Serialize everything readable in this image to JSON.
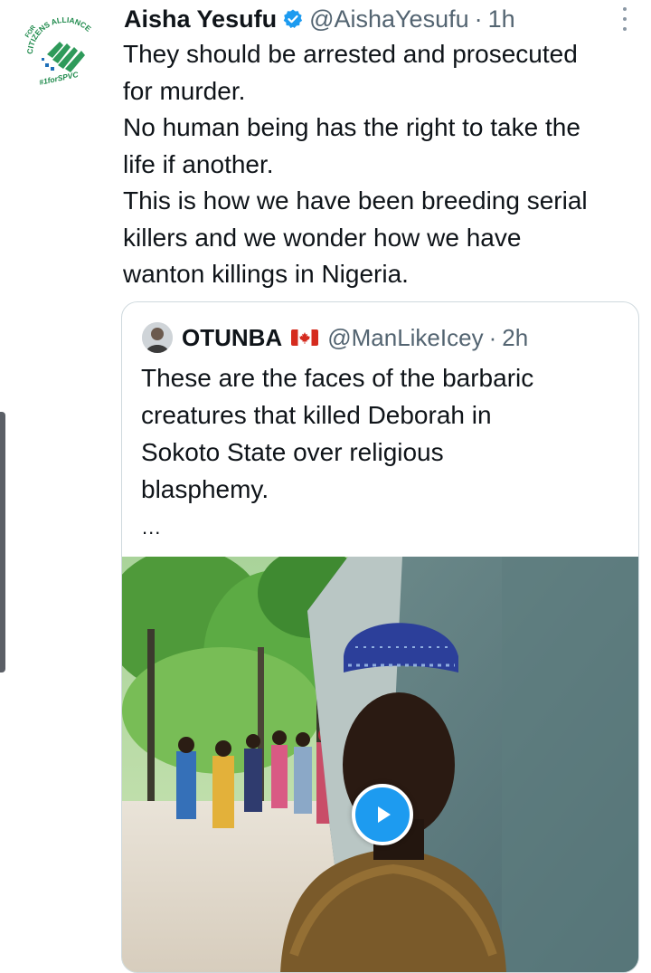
{
  "tweet": {
    "author_name": "Aisha Yesufu",
    "handle": "@AishaYesufu",
    "separator": "·",
    "time": "1h",
    "verified_icon": "verified-badge-icon",
    "more_icon": "more-vertical-icon",
    "avatar_logo_text": [
      "CITIZENS ALLIANCE",
      "FOR",
      "#1forSPVC"
    ],
    "lines": [
      "They should be arrested and prosecuted",
      "for murder.",
      "No human being has the right to take the",
      "life if another.",
      "This is how we have been breeding serial",
      "killers and we wonder how we have",
      "wanton killings in Nigeria."
    ]
  },
  "quote": {
    "author_name": "OTUNBA",
    "flag_icon": "canada-flag-icon",
    "handle": "@ManLikeIcey",
    "separator": "·",
    "time": "2h",
    "lines": [
      "These are the faces of the barbaric",
      "creatures that killed Deborah in",
      "Sokoto State over religious",
      "blasphemy."
    ],
    "ellipsis": "...",
    "media": {
      "type": "video",
      "play_icon": "play-icon"
    }
  },
  "colors": {
    "accent": "#1d9bf0",
    "text": "#0f1419",
    "secondary_text": "#536471",
    "border": "#cfd9de"
  }
}
